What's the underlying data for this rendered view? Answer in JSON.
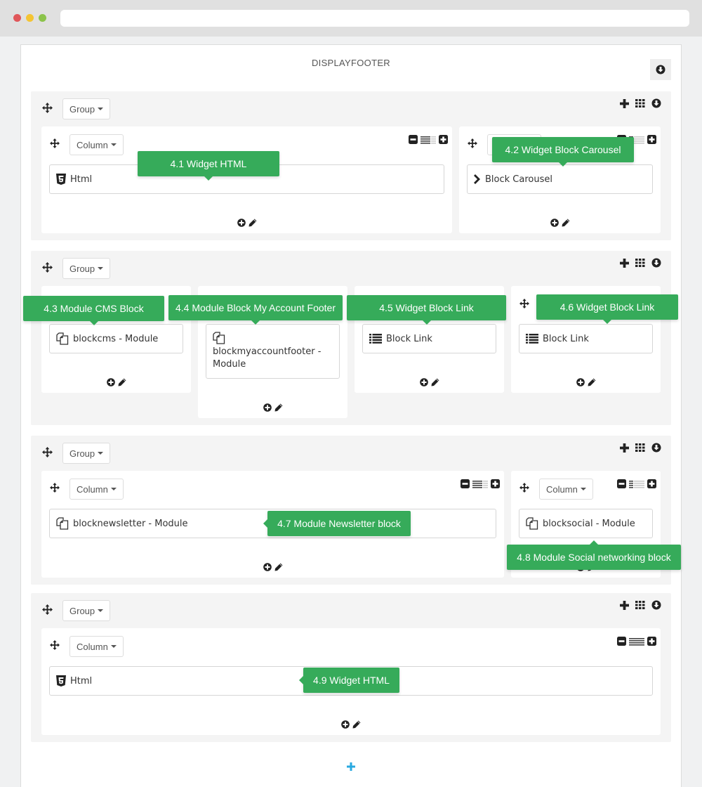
{
  "browser": {
    "url": ""
  },
  "hook": {
    "title": "DISPLAYFOOTER"
  },
  "labels": {
    "group": "Group",
    "column": "Column"
  },
  "colors": {
    "tooltip": "#36ab5a",
    "add_row": "#29a9e0"
  },
  "groups": [
    {
      "columns": [
        {
          "widget": {
            "icon": "html5-icon",
            "label": "Html"
          },
          "tooltip": "4.1 Widget HTML"
        },
        {
          "widget": {
            "icon": "chevron-right-icon",
            "label": "Block Carousel"
          },
          "tooltip": "4.2 Widget Block Carousel"
        }
      ]
    },
    {
      "columns": [
        {
          "widget": {
            "icon": "module-icon",
            "label": "blockcms - Module"
          },
          "tooltip": "4.3 Module CMS Block"
        },
        {
          "widget": {
            "icon": "module-icon",
            "label": "blockmyaccountfooter - Module"
          },
          "tooltip": "4.4 Module Block My Account Footer"
        },
        {
          "widget": {
            "icon": "list-icon",
            "label": "Block Link"
          },
          "tooltip": "4.5 Widget Block Link"
        },
        {
          "widget": {
            "icon": "list-icon",
            "label": "Block Link"
          },
          "tooltip": "4.6 Widget Block Link"
        }
      ]
    },
    {
      "columns": [
        {
          "widget": {
            "icon": "module-icon",
            "label": "blocknewsletter - Module"
          },
          "tooltip": "4.7 Module Newsletter block"
        },
        {
          "widget": {
            "icon": "module-icon",
            "label": "blocksocial - Module"
          },
          "tooltip": "4.8 Module Social networking block"
        }
      ]
    },
    {
      "columns": [
        {
          "widget": {
            "icon": "html5-icon",
            "label": "Html"
          },
          "tooltip": "4.9 Widget HTML"
        }
      ]
    }
  ]
}
